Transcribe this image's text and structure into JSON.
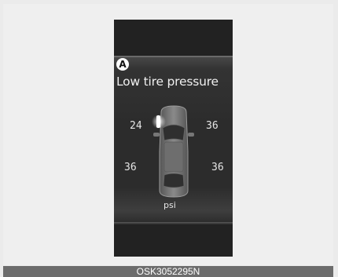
{
  "display": {
    "marker": "A",
    "title": "Low tire pressure",
    "tires": {
      "front_left": "24",
      "front_right": "36",
      "rear_left": "36",
      "rear_right": "36"
    },
    "low_tire": "front_left",
    "unit": "psi"
  },
  "caption": "OSK3052295N",
  "colors": {
    "background": "#ebebeb",
    "cluster": "#222222",
    "panel": "#2c2c2c",
    "text": "#f0f0f0",
    "warning_glow": "#ffffff",
    "caption_bar": "#6c6c6c"
  }
}
